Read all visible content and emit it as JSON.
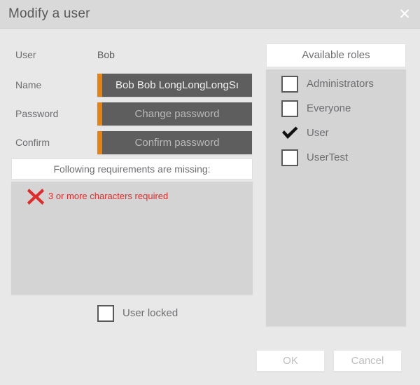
{
  "window": {
    "title": "Modify a user",
    "close_icon": "close-icon"
  },
  "form": {
    "user": {
      "label": "User",
      "value": "Bob"
    },
    "name": {
      "label": "Name",
      "value": "Bob Bob LongLongLongSı"
    },
    "password": {
      "label": "Password",
      "placeholder": "Change password"
    },
    "confirm": {
      "label": "Confirm",
      "placeholder": "Confirm password"
    }
  },
  "requirements": {
    "header": "Following requirements are missing:",
    "items": [
      {
        "icon": "red-x-icon",
        "text": "3 or more characters required"
      }
    ]
  },
  "user_locked": {
    "label": "User locked",
    "checked": false
  },
  "roles": {
    "header": "Available roles",
    "items": [
      {
        "label": "Administrators",
        "checked": false
      },
      {
        "label": "Everyone",
        "checked": false
      },
      {
        "label": "User",
        "checked": true
      },
      {
        "label": "UserTest",
        "checked": false
      }
    ]
  },
  "footer": {
    "ok_label": "OK",
    "cancel_label": "Cancel"
  },
  "colors": {
    "titlebar": "#d9d9d9",
    "body": "#e8e8e8",
    "panel": "#d4d4d4",
    "input_bg": "#5e5e5e",
    "accent_orange": "#e8820c",
    "error_red": "#e02b2b",
    "text_gray": "#6d6e71"
  }
}
